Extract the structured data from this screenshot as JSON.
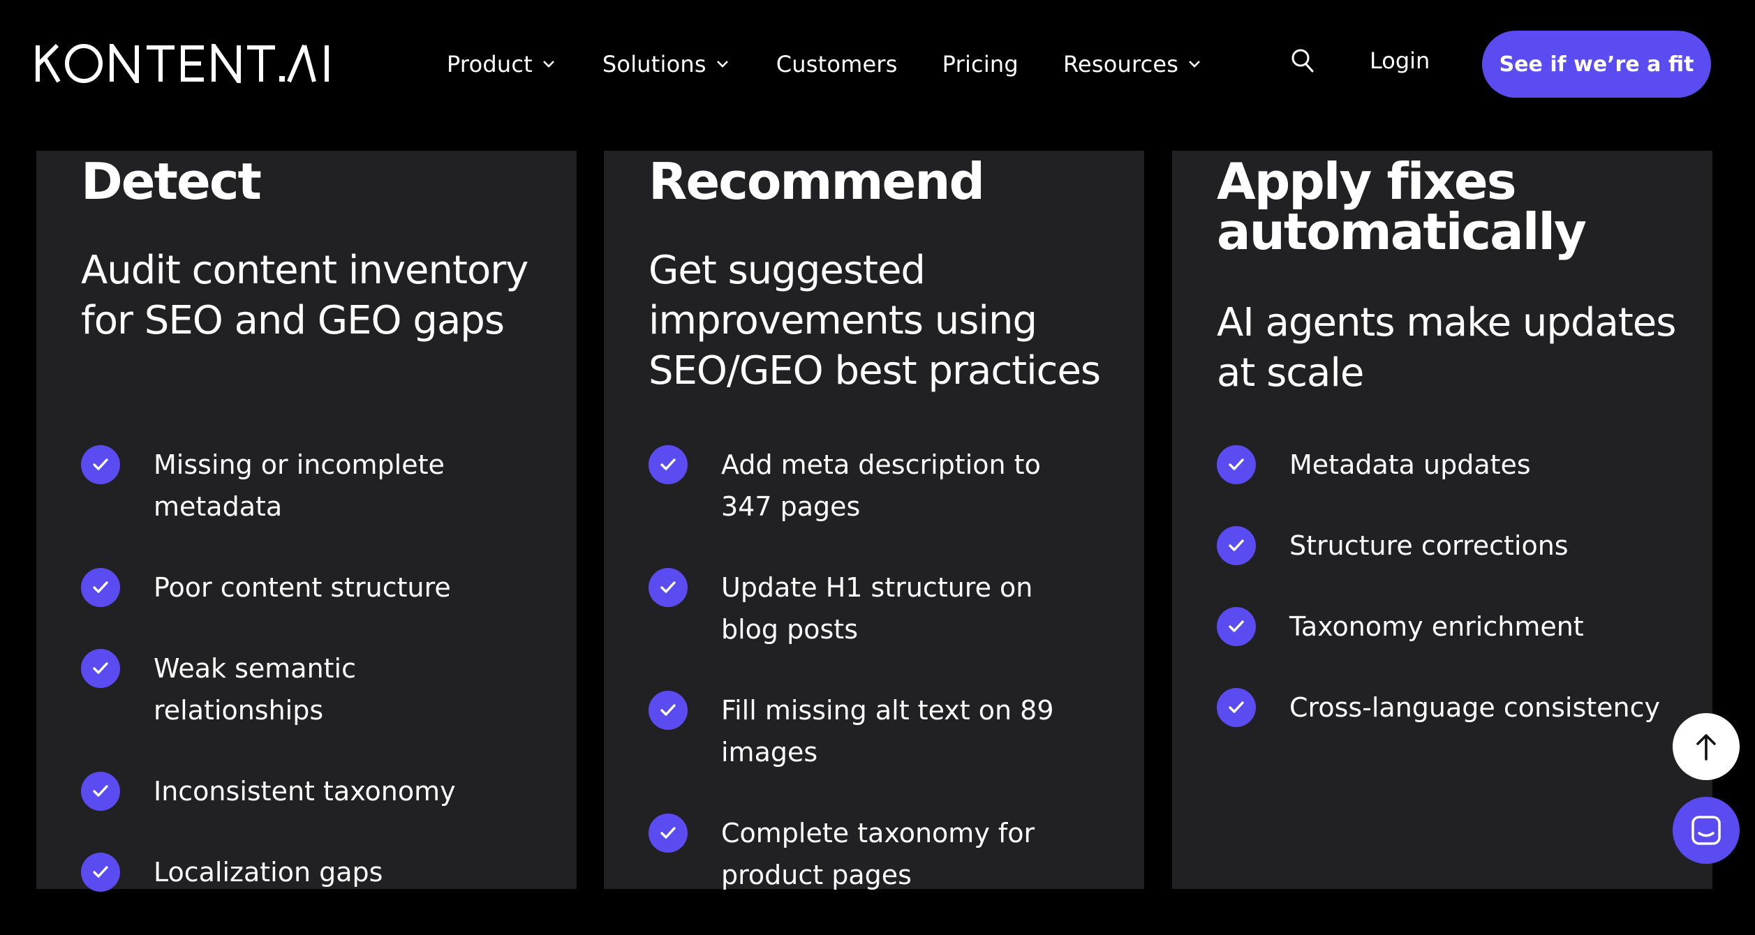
{
  "brand": {
    "logo_text": "KONTENT.AI",
    "accent_color": "#5b4cf2",
    "card_color": "#212124",
    "background_color": "#000000"
  },
  "nav": {
    "items": [
      {
        "label": "Product",
        "has_dropdown": true
      },
      {
        "label": "Solutions",
        "has_dropdown": true
      },
      {
        "label": "Customers",
        "has_dropdown": false
      },
      {
        "label": "Pricing",
        "has_dropdown": false
      },
      {
        "label": "Resources",
        "has_dropdown": true
      }
    ],
    "search_icon": "search-icon",
    "login_label": "Login",
    "cta_label": "See if we’re a fit"
  },
  "cards": [
    {
      "title": "Detect",
      "subtitle": "Audit content inventory for SEO and GEO gaps",
      "items": [
        "Missing or incomplete metadata",
        "Poor content structure",
        "Weak semantic relationships",
        "Inconsistent taxonomy",
        "Localization gaps"
      ]
    },
    {
      "title": "Recommend",
      "subtitle": "Get suggested improvements using SEO/GEO best practices",
      "items": [
        "Add meta description to 347 pages",
        "Update H1 structure on blog posts",
        "Fill missing alt text on 89 images",
        "Complete taxonomy for product pages"
      ]
    },
    {
      "title": "Apply fixes automatically",
      "subtitle": "AI agents make updates at scale",
      "items": [
        "Metadata updates",
        "Structure corrections",
        "Taxonomy enrichment",
        "Cross-language consistency"
      ]
    }
  ],
  "floating": {
    "back_to_top_icon": "arrow-up-icon",
    "chat_icon": "chat-icon"
  }
}
